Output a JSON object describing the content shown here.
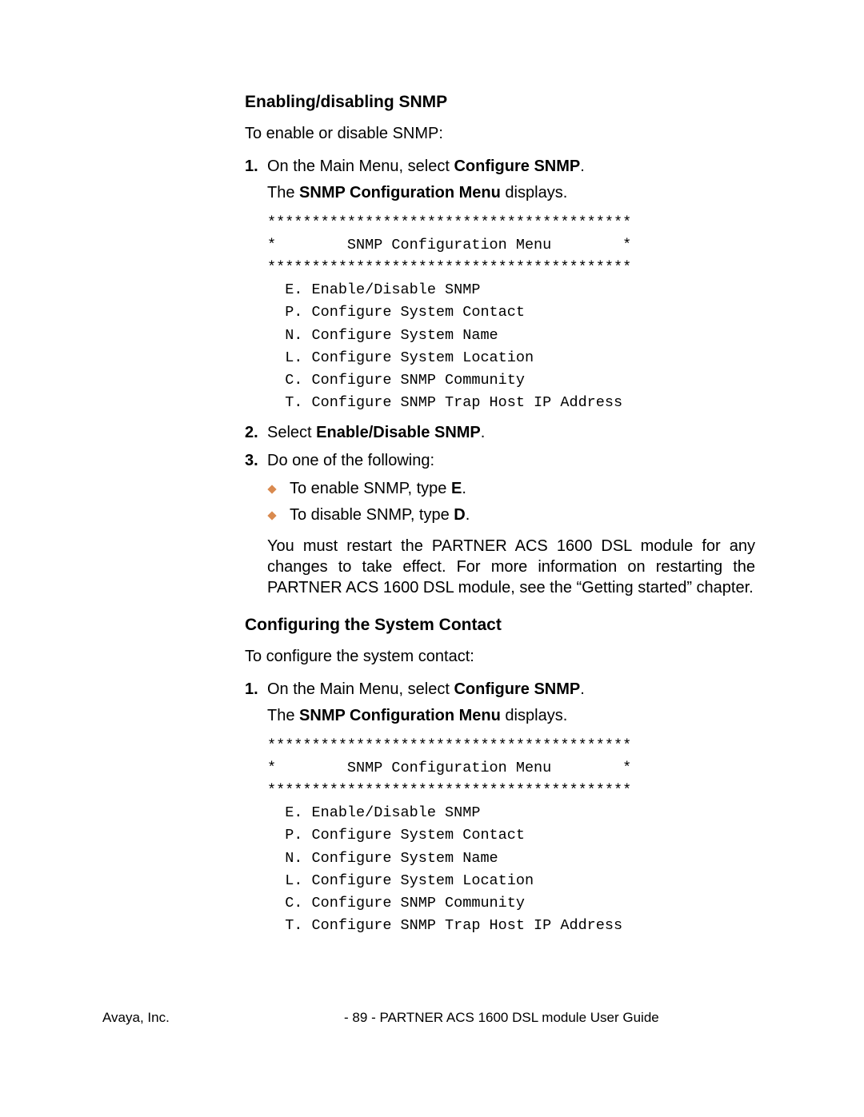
{
  "section1": {
    "heading": "Enabling/disabling SNMP",
    "intro": "To enable or disable SNMP:",
    "step1_num": "1.",
    "step1_text_pre": "On the Main Menu, select ",
    "step1_text_bold": "Configure SNMP",
    "step1_text_post": ".",
    "step1_cont_pre": "The ",
    "step1_cont_bold": "SNMP Configuration Menu",
    "step1_cont_post": " displays.",
    "code": "*****************************************\n*        SNMP Configuration Menu        *\n*****************************************\n  E. Enable/Disable SNMP\n  P. Configure System Contact\n  N. Configure System Name\n  L. Configure System Location\n  C. Configure SNMP Community\n  T. Configure SNMP Trap Host IP Address",
    "step2_num": "2.",
    "step2_pre": "Select ",
    "step2_bold": "Enable/Disable SNMP",
    "step2_post": ".",
    "step3_num": "3.",
    "step3_text": "Do one of the following:",
    "bullet1_pre": "To enable SNMP, type ",
    "bullet1_bold": "E",
    "bullet1_post": ".",
    "bullet2_pre": "To disable SNMP, type ",
    "bullet2_bold": "D",
    "bullet2_post": ".",
    "note": "You must restart the PARTNER ACS 1600 DSL module for any changes to take effect.  For more information on restarting the PARTNER ACS 1600 DSL module, see the “Getting started” chapter."
  },
  "section2": {
    "heading": "Configuring the System Contact",
    "intro": "To configure the system contact:",
    "step1_num": "1.",
    "step1_text_pre": "On the Main Menu, select ",
    "step1_text_bold": "Configure SNMP",
    "step1_text_post": ".",
    "step1_cont_pre": "The ",
    "step1_cont_bold": "SNMP Configuration Menu",
    "step1_cont_post": " displays.",
    "code": "*****************************************\n*        SNMP Configuration Menu        *\n*****************************************\n  E. Enable/Disable SNMP\n  P. Configure System Contact\n  N. Configure System Name\n  L. Configure System Location\n  C. Configure SNMP Community\n  T. Configure SNMP Trap Host IP Address"
  },
  "footer": {
    "left": "Avaya, Inc.",
    "center": "- 89 -  PARTNER ACS 1600 DSL module User Guide"
  }
}
